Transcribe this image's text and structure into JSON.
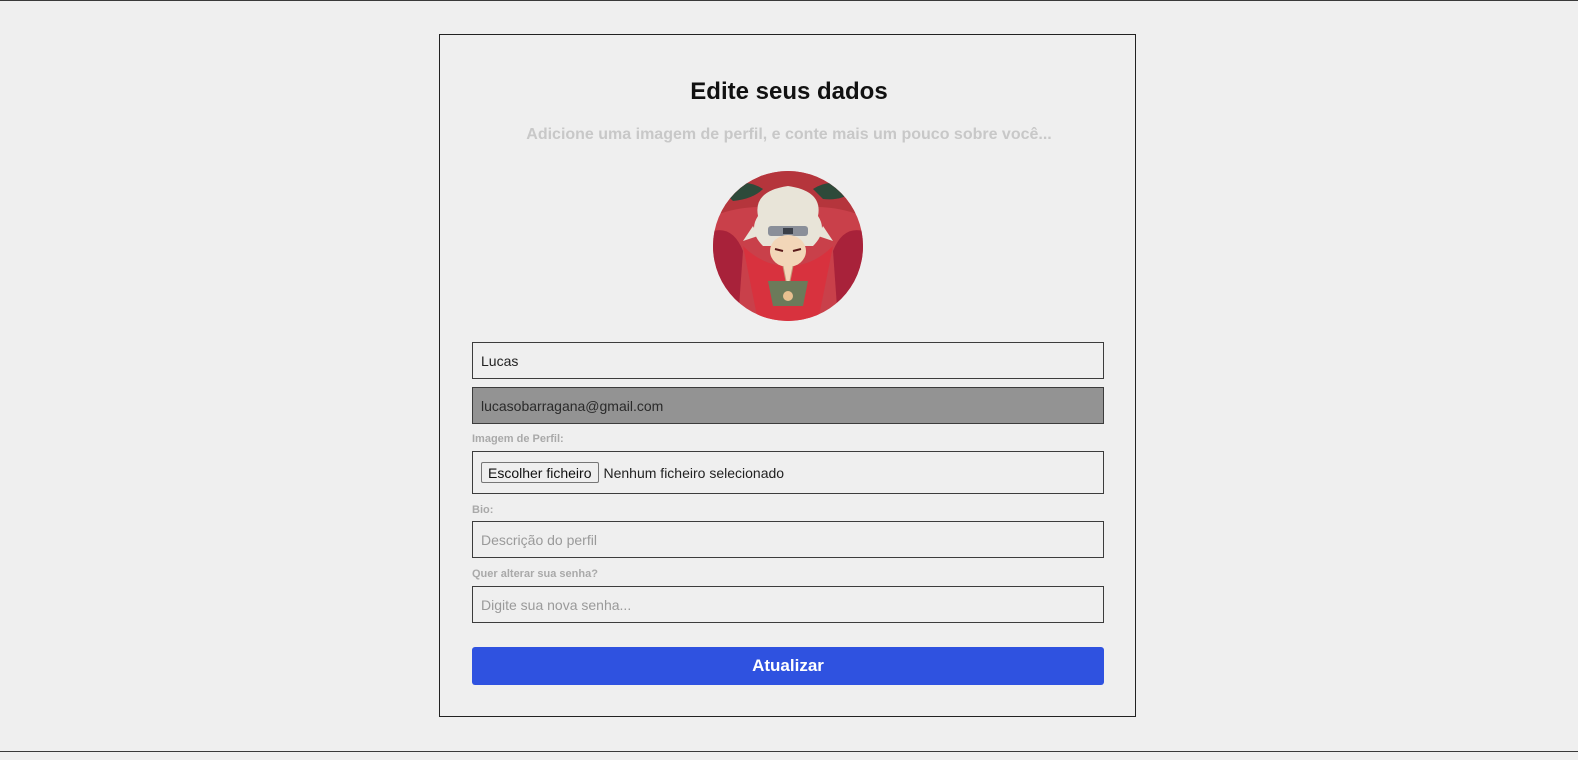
{
  "page": {
    "title": "Edite seus dados",
    "subtitle": "Adicione uma imagem de perfil, e conte mais um pouco sobre você..."
  },
  "avatar": {
    "alt": "Foto de perfil"
  },
  "form": {
    "name_value": "Lucas",
    "email_value": "lucasobarragana@gmail.com",
    "image_label": "Imagem de Perfil:",
    "file_button_label": "Escolher ficheiro",
    "file_status": "Nenhum ficheiro selecionado",
    "bio_label": "Bio:",
    "bio_placeholder": "Descrição do perfil",
    "password_label": "Quer alterar sua senha?",
    "password_placeholder": "Digite sua nova senha...",
    "submit_label": "Atualizar"
  },
  "colors": {
    "accent": "#2f52e0",
    "background": "#efefef",
    "disabled_field": "#939393"
  }
}
